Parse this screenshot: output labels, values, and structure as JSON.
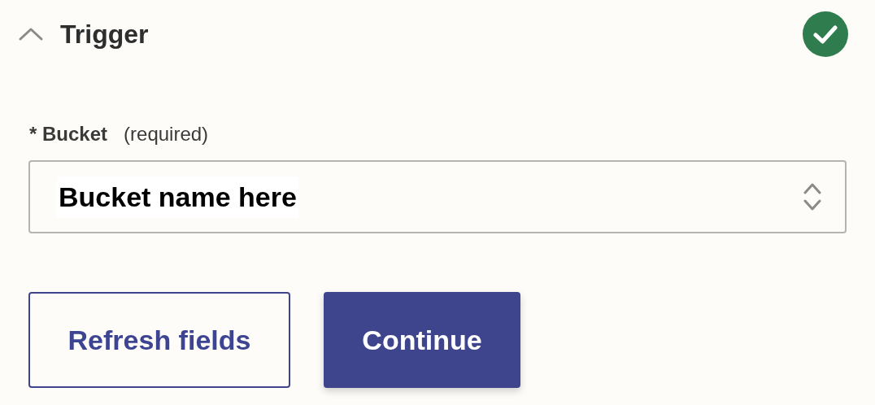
{
  "section": {
    "title": "Trigger",
    "expanded": true,
    "completed": true
  },
  "field": {
    "required_mark": "*",
    "label": "Bucket",
    "hint": "(required)",
    "value": "Bucket name here"
  },
  "buttons": [
    {
      "label": "Refresh fields",
      "kind": "secondary"
    },
    {
      "label": "Continue",
      "kind": "primary"
    }
  ]
}
